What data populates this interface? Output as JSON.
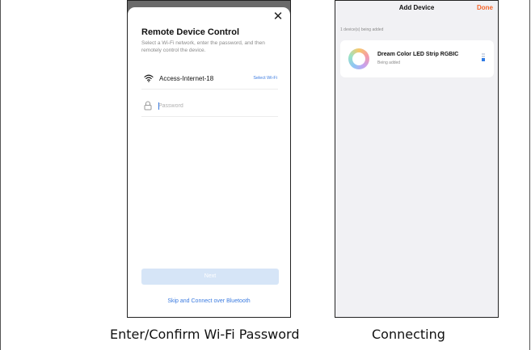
{
  "wifi_screen": {
    "title": "Remote Device Control",
    "description": "Select a Wi-Fi network, enter the password, and then remotely control the device.",
    "wifi_name": "Access-Internet-18",
    "select_wifi_label": "Select Wi-Fi",
    "password_placeholder": "Password",
    "password_value": "",
    "next_label": "Next",
    "skip_label": "Skip and Connect over Bluetooth",
    "caption": "Enter/Confirm Wi-Fi Password"
  },
  "add_screen": {
    "title": "Add Device",
    "done_label": "Done",
    "count_text": "1 device(s) being added",
    "device_name": "Dream Color LED Strip RGBIC",
    "device_status": "Being added",
    "caption": "Connecting"
  },
  "colors": {
    "accent_blue": "#3b7be0",
    "done_orange": "#f5652a",
    "next_disabled": "#d6e5f7"
  },
  "icons": [
    "close-icon",
    "wifi-icon",
    "lock-icon",
    "device-ring-icon",
    "progress-icon"
  ]
}
